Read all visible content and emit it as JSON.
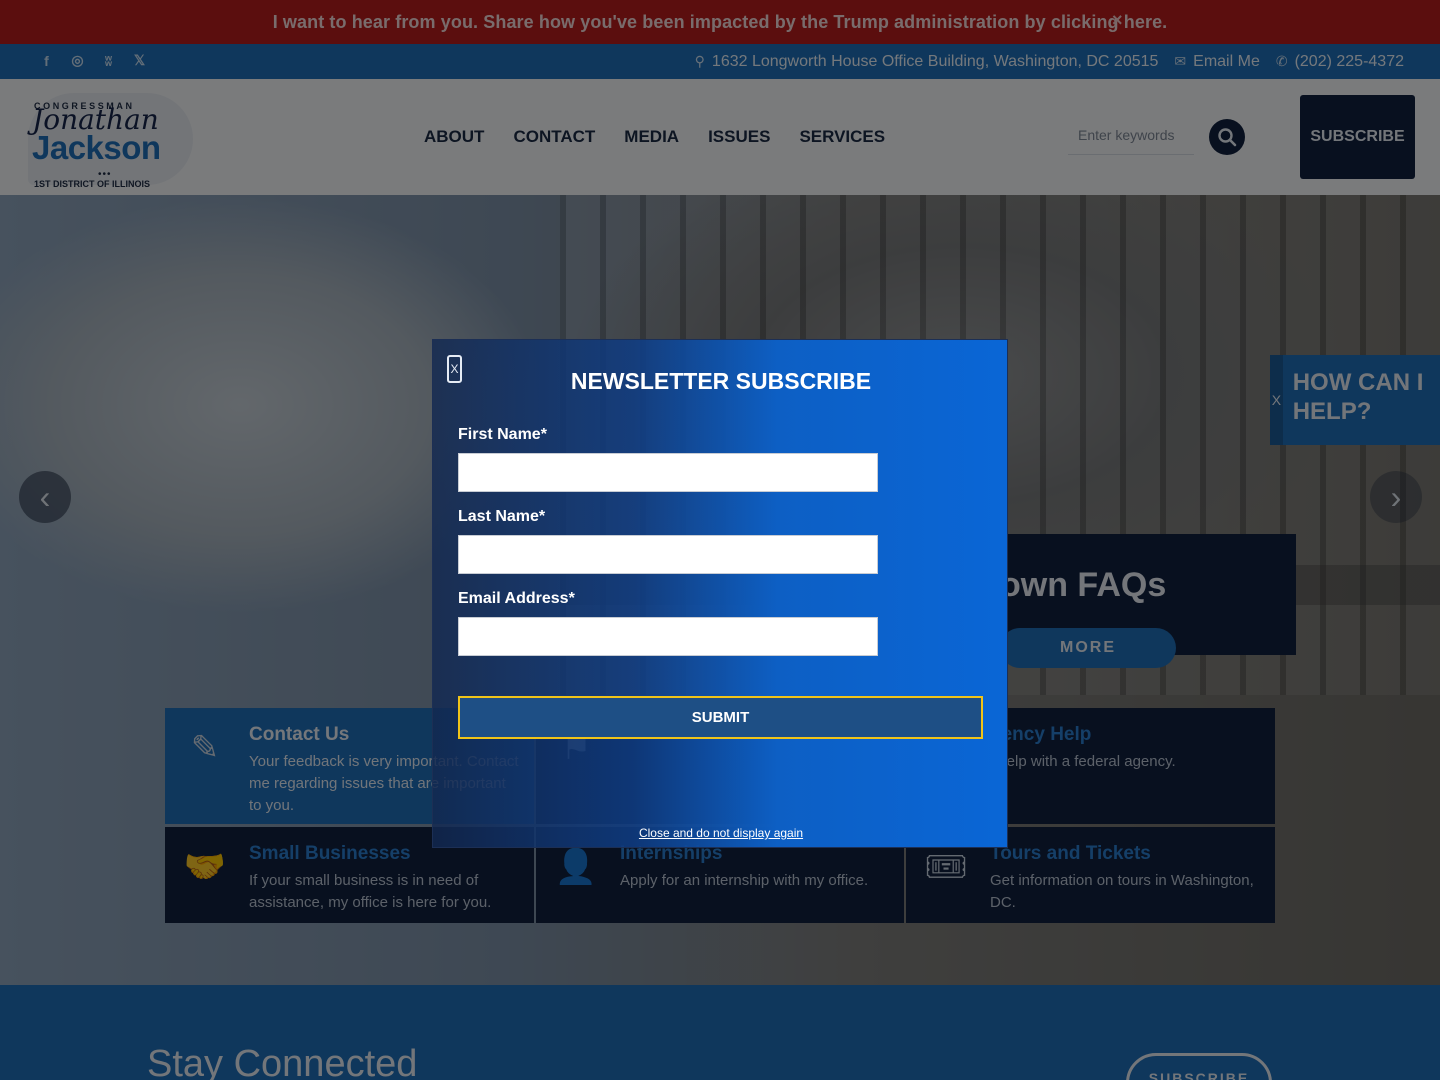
{
  "alert": {
    "text": "I want to hear from you. Share how you've been impacted by the Trump administration by clicking here.",
    "close": "×"
  },
  "utility": {
    "social": [
      "f",
      "◎",
      "ʬ",
      "𝕏"
    ],
    "address": "1632 Longworth House Office Building, Washington, DC 20515",
    "email": "Email Me",
    "phone": "(202) 225-4372"
  },
  "logo": {
    "top": "CONGRESSMAN",
    "first": "Jonathan",
    "last": "Jackson",
    "dots": "•••",
    "sub": "1ST DISTRICT OF ILLINOIS"
  },
  "nav": [
    "ABOUT",
    "CONTACT",
    "MEDIA",
    "ISSUES",
    "SERVICES"
  ],
  "search": {
    "placeholder": "Enter keywords"
  },
  "subscribe_label": "SUBSCRIBE",
  "hero": {
    "arrow_left": "‹",
    "arrow_right": "›",
    "help_x": "X",
    "help_text": "HOW CAN I HELP?",
    "slide_title": "own FAQs",
    "slide_more": "MORE"
  },
  "quick_links": [
    {
      "title": "Contact Us",
      "desc": "Your feedback is very important. Contact me regarding issues that are important to you."
    },
    {
      "title": "",
      "desc": ""
    },
    {
      "title": "gency Help",
      "desc": "t help with a federal agency."
    },
    {
      "title": "Small Businesses",
      "desc": "If your small business is in need of assistance, my office is here for you."
    },
    {
      "title": "Internships",
      "desc": "Apply for an internship with my office."
    },
    {
      "title": "Tours and Tickets",
      "desc": "Get information on tours in Washington, DC."
    }
  ],
  "stay": {
    "title": "Stay Connected",
    "button": "SUBSCRIBE"
  },
  "modal": {
    "close": "X",
    "title": "NEWSLETTER SUBSCRIBE",
    "first_name": "First Name*",
    "last_name": "Last Name*",
    "email": "Email Address*",
    "submit": "SUBMIT",
    "dismiss": "Close and do not display again"
  },
  "colors": {
    "alert": "#b71c1c",
    "brand_blue": "#1f6fb8",
    "navy": "#10213f",
    "modal_blue": "#0a66d6",
    "submit_border": "#f0c419"
  }
}
